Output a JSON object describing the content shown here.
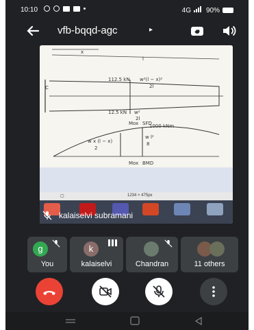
{
  "status_bar": {
    "time": "10:10",
    "network": "4G",
    "battery": "90%"
  },
  "top_bar": {
    "meeting_code": "vfb-bqqd-agc",
    "caret": "▸"
  },
  "shared_screen": {
    "annotations": {
      "load_top": "112.5 kN",
      "load_bottom": "12.5 kN",
      "point_load": "1000 kNm",
      "sfd_label": "SFD",
      "bmd_label": "BMD"
    },
    "status_readout": "1234 × 475px"
  },
  "presenter": {
    "name": "kalaiselvi subramani"
  },
  "participants": [
    {
      "label": "You",
      "initial": "g",
      "color": "#33a852",
      "muted": true
    },
    {
      "label": "kalaiselvi",
      "initial": "k",
      "color": "#8a6d6a",
      "speaking": true
    },
    {
      "label": "Chandran",
      "initial": "",
      "color": "#6b7b6e",
      "muted": true
    },
    {
      "label": "11 others",
      "initial": "",
      "color": "#7a5a4a"
    }
  ],
  "colors": {
    "end_call": "#ea4335",
    "control_bg": "#ffffff",
    "background": "#202124",
    "tile_bg": "#3c4043"
  }
}
